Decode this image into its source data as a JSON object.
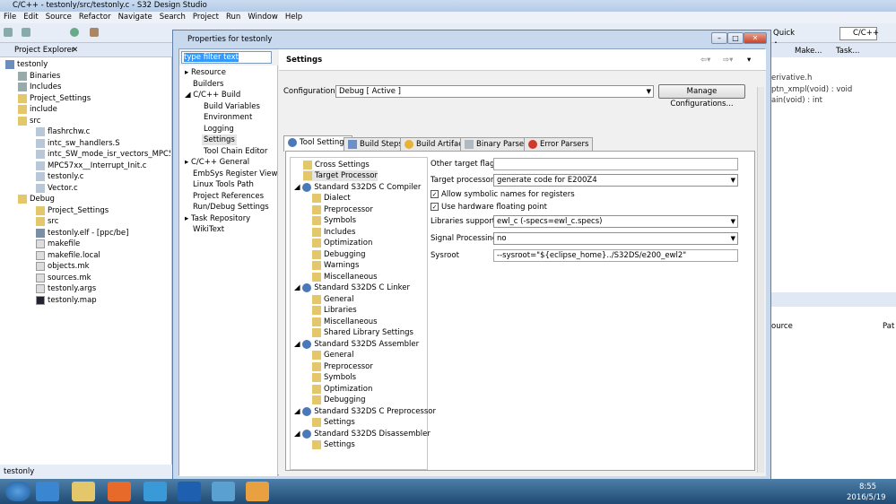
{
  "window": {
    "title": "C/C++ - testonly/src/testonly.c - S32 Design Studio"
  },
  "menu": [
    "File",
    "Edit",
    "Source",
    "Refactor",
    "Navigate",
    "Search",
    "Project",
    "Run",
    "Window",
    "Help"
  ],
  "toolbar": {
    "quick_access": "Quick Access",
    "perspective": "C/C++"
  },
  "explorer": {
    "title": "Project Explorer",
    "items": [
      {
        "label": "testonly"
      },
      {
        "label": "Binaries"
      },
      {
        "label": "Includes"
      },
      {
        "label": "Project_Settings"
      },
      {
        "label": "include"
      },
      {
        "label": "src"
      },
      {
        "label": "flashrchw.c"
      },
      {
        "label": "intc_sw_handlers.S"
      },
      {
        "label": "intc_SW_mode_isr_vectors_MPC5744P.c"
      },
      {
        "label": "MPC57xx__Interrupt_Init.c"
      },
      {
        "label": "testonly.c"
      },
      {
        "label": "Vector.c"
      },
      {
        "label": "Debug"
      },
      {
        "label": "Project_Settings"
      },
      {
        "label": "src"
      },
      {
        "label": "testonly.elf - [ppc/be]"
      },
      {
        "label": "makefile"
      },
      {
        "label": "makefile.local"
      },
      {
        "label": "objects.mk"
      },
      {
        "label": "sources.mk"
      },
      {
        "label": "testonly.args"
      },
      {
        "label": "testonly.map"
      }
    ]
  },
  "status": {
    "text": "testonly"
  },
  "rightpane": {
    "tab1": "Make...",
    "tab2": "Task...",
    "lines": [
      "erivative.h",
      "ptn_xmpl(void) : void",
      "ain(void) : int"
    ],
    "col_source": "ource",
    "col_path": "Pat"
  },
  "dialog": {
    "title": "Properties for testonly",
    "filter_text": "type filter text",
    "nav": [
      {
        "label": "Resource"
      },
      {
        "label": "Builders"
      },
      {
        "label": "C/C++ Build"
      },
      {
        "label": "Build Variables"
      },
      {
        "label": "Environment"
      },
      {
        "label": "Logging"
      },
      {
        "label": "Settings"
      },
      {
        "label": "Tool Chain Editor"
      },
      {
        "label": "C/C++ General"
      },
      {
        "label": "EmbSys Register View"
      },
      {
        "label": "Linux Tools Path"
      },
      {
        "label": "Project References"
      },
      {
        "label": "Run/Debug Settings"
      },
      {
        "label": "Task Repository"
      },
      {
        "label": "WikiText"
      }
    ],
    "settings_title": "Settings",
    "configuration_label": "Configuration:",
    "configuration_value": "Debug  [ Active ]",
    "manage_button": "Manage Configurations...",
    "tabs": [
      "Tool Settings",
      "Build Steps",
      "Build Artifact",
      "Binary Parsers",
      "Error Parsers"
    ],
    "tool_tree": [
      {
        "label": "Cross Settings"
      },
      {
        "label": "Target Processor"
      },
      {
        "label": "Standard S32DS C Compiler"
      },
      {
        "label": "Dialect"
      },
      {
        "label": "Preprocessor"
      },
      {
        "label": "Symbols"
      },
      {
        "label": "Includes"
      },
      {
        "label": "Optimization"
      },
      {
        "label": "Debugging"
      },
      {
        "label": "Warnings"
      },
      {
        "label": "Miscellaneous"
      },
      {
        "label": "Standard S32DS C Linker"
      },
      {
        "label": "General"
      },
      {
        "label": "Libraries"
      },
      {
        "label": "Miscellaneous"
      },
      {
        "label": "Shared Library Settings"
      },
      {
        "label": "Standard S32DS Assembler"
      },
      {
        "label": "General"
      },
      {
        "label": "Preprocessor"
      },
      {
        "label": "Symbols"
      },
      {
        "label": "Optimization"
      },
      {
        "label": "Debugging"
      },
      {
        "label": "Standard S32DS C Preprocessor"
      },
      {
        "label": "Settings"
      },
      {
        "label": "Standard S32DS Disassembler"
      },
      {
        "label": "Settings"
      }
    ],
    "options": {
      "other_flags_label": "Other target flags",
      "other_flags_value": "",
      "target_processor_label": "Target processor",
      "target_processor_value": "generate code for E200Z4",
      "allow_symbolic_label": "Allow symbolic names for registers",
      "hw_float_label": "Use hardware floating point",
      "libraries_label": "Libraries support",
      "libraries_value": "ewl_c (-specs=ewl_c.specs)",
      "signal_label": "Signal Processing",
      "signal_value": "no",
      "sysroot_label": "Sysroot",
      "sysroot_value": "--sysroot=\"${eclipse_home}../S32DS/e200_ewl2\""
    }
  },
  "taskbar": {
    "time": "8:55",
    "date": "2016/5/19"
  }
}
